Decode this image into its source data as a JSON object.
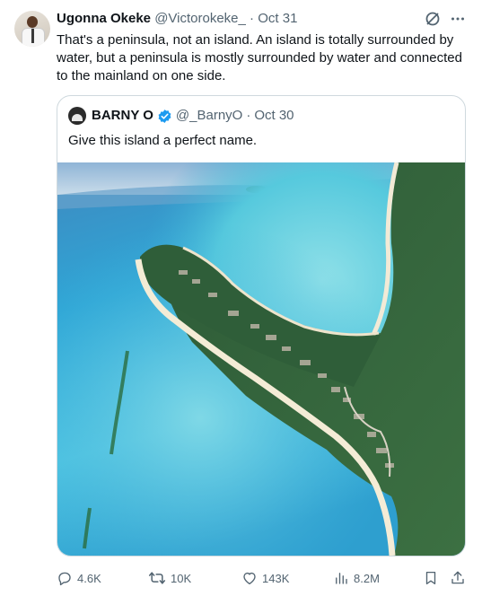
{
  "post": {
    "author_name": "Ugonna Okeke",
    "author_handle": "@Victorokeke_",
    "separator": "·",
    "date": "Oct 31",
    "text": "That's a peninsula, not an island. An island is totally surrounded by water, but a peninsula is mostly surrounded by water and connected to the mainland on one side."
  },
  "quoted": {
    "author_name": "BARNY O",
    "author_handle": "@_BarnyO",
    "separator": "·",
    "date": "Oct 30",
    "text": "Give this island a perfect name."
  },
  "actions": {
    "replies": "4.6K",
    "reposts": "10K",
    "likes": "143K",
    "views": "8.2M"
  },
  "colors": {
    "muted": "#536471",
    "verified": "#1d9bf0",
    "border": "#cfd9de",
    "grok": "#536471"
  },
  "icons": [
    "reply-icon",
    "repost-icon",
    "like-icon",
    "views-icon",
    "bookmark-icon",
    "share-icon",
    "grok-icon",
    "more-icon",
    "verified-badge-icon"
  ]
}
